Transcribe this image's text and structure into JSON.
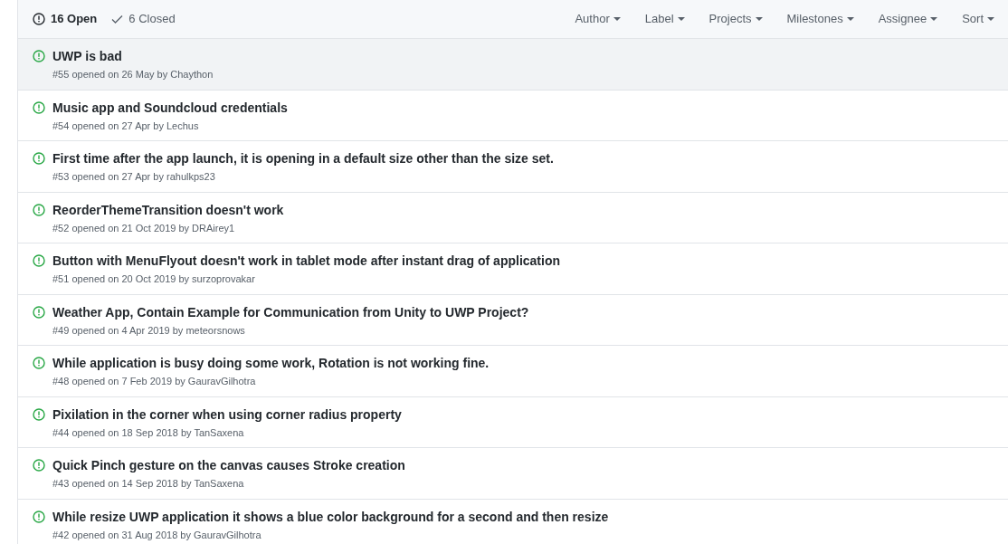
{
  "header": {
    "states": [
      {
        "label": "16 Open",
        "kind": "open",
        "selected": true
      },
      {
        "label": "6 Closed",
        "kind": "closed",
        "selected": false
      }
    ],
    "filters": [
      "Author",
      "Label",
      "Projects",
      "Milestones",
      "Assignee",
      "Sort"
    ]
  },
  "issues": [
    {
      "title": "UWP is bad",
      "meta": "#55 opened on 26 May by Chaython",
      "highlighted": true
    },
    {
      "title": "Music app and Soundcloud credentials",
      "meta": "#54 opened on 27 Apr by Lechus",
      "highlighted": false
    },
    {
      "title": "First time after the app launch, it is opening in a default size other than the size set.",
      "meta": "#53 opened on 27 Apr by rahulkps23",
      "highlighted": false
    },
    {
      "title": "ReorderThemeTransition doesn't work",
      "meta": "#52 opened on 21 Oct 2019 by DRAirey1",
      "highlighted": false
    },
    {
      "title": "Button with MenuFlyout doesn't work in tablet mode after instant drag of application",
      "meta": "#51 opened on 20 Oct 2019 by surzoprovakar",
      "highlighted": false
    },
    {
      "title": "Weather App, Contain Example for Communication from Unity to UWP Project?",
      "meta": "#49 opened on 4 Apr 2019 by meteorsnows",
      "highlighted": false
    },
    {
      "title": "While application is busy doing some work, Rotation is not working fine.",
      "meta": "#48 opened on 7 Feb 2019 by GauravGilhotra",
      "highlighted": false
    },
    {
      "title": "Pixilation in the corner when using corner radius property",
      "meta": "#44 opened on 18 Sep 2018 by TanSaxena",
      "highlighted": false
    },
    {
      "title": "Quick Pinch gesture on the canvas causes Stroke creation",
      "meta": "#43 opened on 14 Sep 2018 by TanSaxena",
      "highlighted": false
    },
    {
      "title": "While resize UWP application it shows a blue color background for a second and then resize",
      "meta": "#42 opened on 31 Aug 2018 by GauravGilhotra",
      "highlighted": false
    }
  ]
}
